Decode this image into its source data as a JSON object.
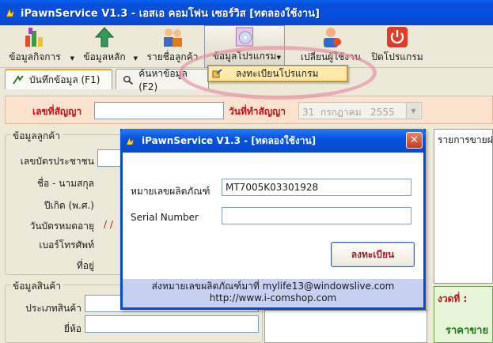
{
  "window": {
    "title": "iPawnService V1.3 - เอสเอ คอมโฟน เซอร์วิส [ทดลองใช้งาน]"
  },
  "toolbar": {
    "items": [
      {
        "label": "ข้อมูลกิจการ",
        "icon": "building-chart-icon"
      },
      {
        "label": "ข้อมูลหลัก",
        "icon": "arrow-up-icon"
      },
      {
        "label": "รายชื่อลูกค้า",
        "icon": "people-icon"
      },
      {
        "label": "ข้อมูลโปรแกรม",
        "icon": "cd-icon"
      },
      {
        "label": "เปลี่ยนผู้ใช้งาน",
        "icon": "user-switch-icon"
      },
      {
        "label": "ปิดโปรแกรม",
        "icon": "power-icon"
      }
    ]
  },
  "menu": {
    "items": [
      {
        "label": "ลงทะเบียนโปรแกรม",
        "icon": "register-icon"
      }
    ]
  },
  "tabs": [
    {
      "label": "บันทึกข้อมูล (F1)",
      "icon": "save-arrow-icon"
    },
    {
      "label": "ค้นหาข้อมูล (F2)",
      "icon": "search-icon"
    }
  ],
  "contract": {
    "number_label": "เลขที่สัญญา",
    "number_value": "",
    "date_label": "วันที่ทำสัญญา",
    "date_day": "31",
    "date_month": "กรกฎาคม",
    "date_year": "2555"
  },
  "customer": {
    "legend": "ข้อมูลลูกค้า",
    "id_label": "เลขบัตรประชาชน",
    "name_label": "ชื่อ - นามสกุล",
    "birth_label": "ปีเกิด (พ.ศ.)",
    "expiry_label": "วันบัตรหมดอายุ",
    "expiry_value": "/ /",
    "phone_label": "เบอร์โทรศัพท์",
    "address_label": "ที่อยู่"
  },
  "product": {
    "legend": "ข้อมูลสินค้า",
    "type_label": "ประเภทสินค้า",
    "brand_label": "ยี่ห้อ"
  },
  "right": {
    "list_title": "รายการขายฝา",
    "period_label": "งวดที่ :",
    "price_label": "ราคาขาย"
  },
  "dialog": {
    "title": "iPawnService V1.3 - [ทดลองใช้งาน]",
    "product_id_label": "หมายเลขผลิตภัณฑ์",
    "product_id_value": "MT7005K03301928",
    "serial_label": "Serial Number",
    "serial_value": "",
    "register_button": "ลงทะเบียน",
    "footer_line1": "ส่งหมายเลขผลิตภัณฑ์มาที่ mylife13@windowslive.com",
    "footer_line2": "http://www.i-comshop.com"
  }
}
